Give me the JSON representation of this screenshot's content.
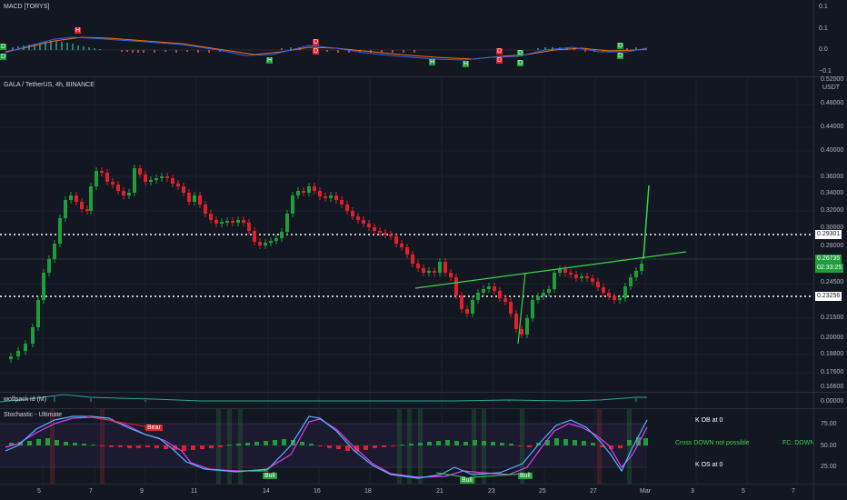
{
  "colors": {
    "background": "#131722",
    "up": "#26a69a",
    "down": "#ef5350",
    "bull_candle": "#1f9d3a",
    "bear_candle": "#e0202a",
    "grid": "#1e222d",
    "trendline": "#39d34b",
    "macd_line": "#2962ff",
    "signal_line": "#ff6d00",
    "stoch_k": "#2196f3",
    "stoch_d": "#e040fb"
  },
  "macd_pane": {
    "label": "MACD [TORYS]",
    "axis_ticks": [
      "0.1",
      "0.1",
      "0.0",
      "−0.1"
    ],
    "markers": [
      "D",
      "D",
      "H",
      "D",
      "D",
      "H",
      "H",
      "H",
      "D",
      "D",
      "D",
      "D",
      "D",
      "D"
    ]
  },
  "main_pane": {
    "label": "GALA / TetherUS, 4h, BINANCE",
    "currency": "USDT",
    "axis_ticks": [
      "0.52000",
      "0.48000",
      "0.44000",
      "0.40000",
      "0.36000",
      "0.34000",
      "0.32000",
      "0.30000",
      "0.28000",
      "0.24500",
      "0.21500",
      "0.20000",
      "0.18800",
      "0.17600",
      "0.16600"
    ],
    "level_upper": "0.29301",
    "level_lower": "0.23256",
    "current_price": "0.26735",
    "countdown": "02:33:25"
  },
  "wolfpack_pane": {
    "label": "wolfpack id (M)",
    "axis_tick": "0.00000"
  },
  "stoch_pane": {
    "label": "Stochastic - Ultimate",
    "axis_ticks": [
      "75.00",
      "50.00",
      "25.00"
    ],
    "labels": {
      "bear": "Bear",
      "bull1": "Bull",
      "bull2": "Bull",
      "bull3": "Bull",
      "k_ob": "K OB at 0",
      "k_os": "K OS at 0",
      "cross": "Cross DOWN not possible",
      "fc": "FC: DOWN ..."
    }
  },
  "time_axis": [
    "5",
    "7",
    "9",
    "11",
    "14",
    "16",
    "18",
    "21",
    "23",
    "25",
    "27",
    "Mar",
    "3",
    "5",
    "7"
  ]
}
